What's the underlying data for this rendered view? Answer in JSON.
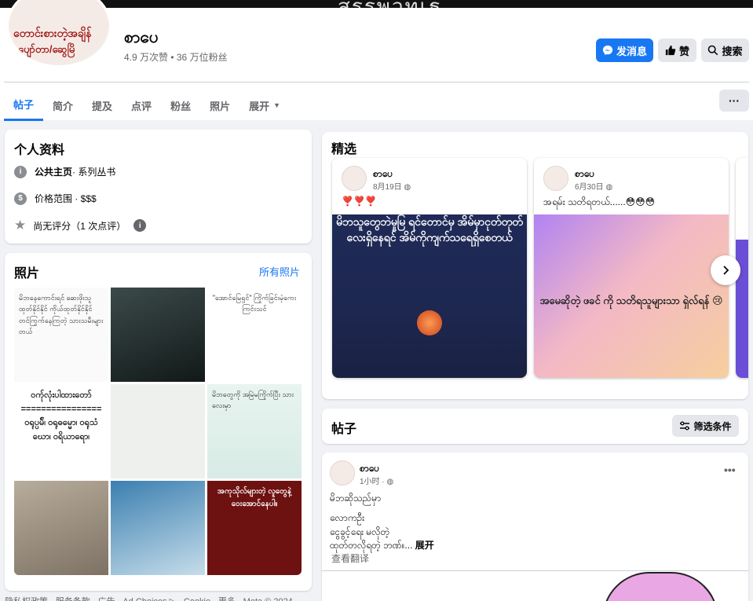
{
  "cover": {
    "text": "สรรพวทเธ"
  },
  "avatar": {
    "line1": "တောင်းစားတဲ့အချိန်",
    "line2": "ပျော်တာ/ဆွေမြိ"
  },
  "page": {
    "name": "စာပေ",
    "stats": "4.9 万次赞 • 36 万位粉丝"
  },
  "buttons": {
    "message": "发消息",
    "like": "赞",
    "search": "搜索"
  },
  "tabs": [
    {
      "label": "帖子"
    },
    {
      "label": "简介"
    },
    {
      "label": "提及"
    },
    {
      "label": "点评"
    },
    {
      "label": "粉丝"
    },
    {
      "label": "照片"
    },
    {
      "label": "展开"
    }
  ],
  "more": "···",
  "intro": {
    "title": "个人资料",
    "public_page_label": "公共主页",
    "public_page_value": " · 系列丛书",
    "price_range": "价格范围 · $$$",
    "rating": "尚无评分（1 次点评）"
  },
  "photos": {
    "title": "照片",
    "see_all": "所有照片",
    "items": [
      "မိဘနေကောင်းရင် ဆေးဖိုးသူထုတ်နိုင်နိုင် ကိုယ်ထုတ်နိုင်နိုင် တင်ကြွက်နေကြတဲ့ သားသမီးများတယ်",
      "",
      "\"အောင်မြေရှင်\" ကြိုက်ခြင်းမဲ့ကေးကြင်းသင်",
      "ဝက်ုလုံးပါထားတော် ================ ဝရုပ္ပမ်ိ၊ ဝရုဓမ္မော၊ ဝရုသံဃော၊ ဝရိယာရော၊",
      "",
      "မိဘတွေကို အမြဲမကြိုက်ပြီး သားလေးမှာ",
      "",
      "",
      "အကုသိုလ်များတဲ့ လူတွေနဲ့ ဝေးအောင်နေပါ။"
    ]
  },
  "footer": "隐私权政策 · 服务条款 · 广告 · Ad Choices ▷ · Cookie · 更多 · Meta © 2024",
  "featured": {
    "title": "精选",
    "cards": [
      {
        "name": "စာပေ",
        "date": "8月19日",
        "text": "❣️❣️❣️",
        "image_text": "မိဘသူတွေဘဲမှုမြ ရင်တောင်မှ အိမ်မှာငုတ်တုတ်လေးရှိနေရင် အိမ်ကိုကျက်သရေရှိစေတယ်"
      },
      {
        "name": "စာပေ",
        "date": "6月30日",
        "text": "အရမ်း သတိရတယ်......😳😳😳",
        "image_text": "အမေဆိုတဲ့ ဖခင် ကို သတိရသူများသာ ရှဲလ်ရန် 😢"
      }
    ]
  },
  "posts": {
    "title": "帖子",
    "filter": "筛选条件",
    "post": {
      "name": "စာပေ",
      "time": "1小时 ·",
      "line1": "မိဘဆိုသည်မှာ",
      "line2": "လောကဦး",
      "line3": "ငွေခွင့်ရေး မလိုတဲ့",
      "line4": "ထုတ်တလိုရတဲ့ ဘဏ်။...",
      "expand": "展开",
      "translate": "查看翻译"
    }
  },
  "colors": {
    "accent": "#1877f2",
    "bg": "#f0f2f5",
    "muted": "#65676b"
  }
}
